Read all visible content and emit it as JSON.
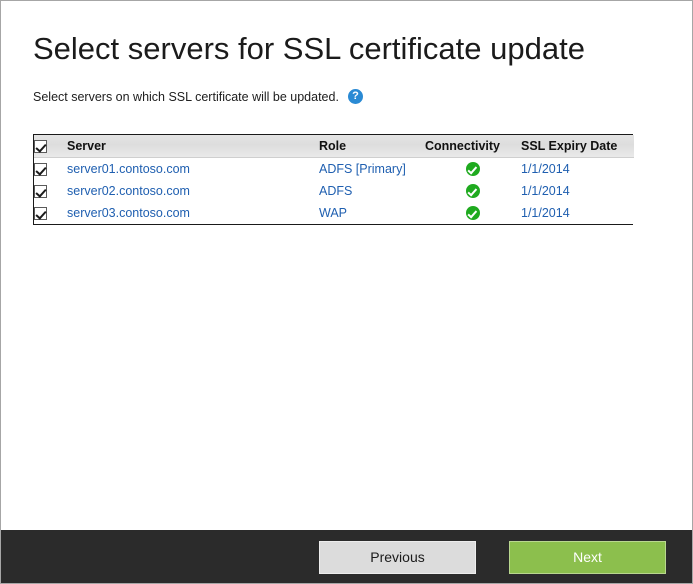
{
  "page": {
    "title": "Select servers for SSL certificate update",
    "subtitle": "Select servers on which SSL certificate will be updated.",
    "help_icon_glyph": "?"
  },
  "table": {
    "header_checkbox_checked": true,
    "columns": [
      {
        "key": "checkbox",
        "label": ""
      },
      {
        "key": "server",
        "label": "Server"
      },
      {
        "key": "role",
        "label": "Role"
      },
      {
        "key": "connectivity",
        "label": "Connectivity"
      },
      {
        "key": "expiry",
        "label": "SSL Expiry Date"
      }
    ],
    "rows": [
      {
        "checked": true,
        "server": "server01.contoso.com",
        "role": "ADFS [Primary]",
        "connectivity": "ok",
        "expiry": "1/1/2014"
      },
      {
        "checked": true,
        "server": "server02.contoso.com",
        "role": "ADFS",
        "connectivity": "ok",
        "expiry": "1/1/2014"
      },
      {
        "checked": true,
        "server": "server03.contoso.com",
        "role": "WAP",
        "connectivity": "ok",
        "expiry": "1/1/2014"
      }
    ]
  },
  "footer": {
    "previous_label": "Previous",
    "next_label": "Next"
  },
  "colors": {
    "link": "#1f5fb0",
    "help_icon": "#2a8ad4",
    "connectivity_ok": "#1faa1f",
    "next_button": "#8cbf4d",
    "previous_button": "#dcdcdc",
    "footer_bar": "#2b2b2b"
  }
}
